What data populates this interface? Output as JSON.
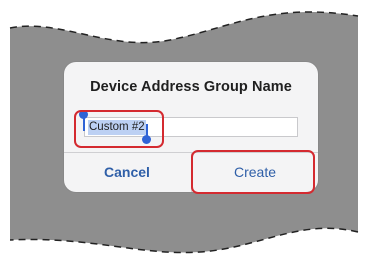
{
  "dialog": {
    "title": "Device Address Group Name",
    "input_value": "Custom #2",
    "cancel_label": "Cancel",
    "create_label": "Create"
  },
  "colors": {
    "backdrop_gray": "#8e8e8e",
    "dialog_bg": "#f4f4f5",
    "button_text": "#2f5fa8",
    "highlight_red": "#d42a30",
    "selection_blue": "#2f63d6"
  }
}
